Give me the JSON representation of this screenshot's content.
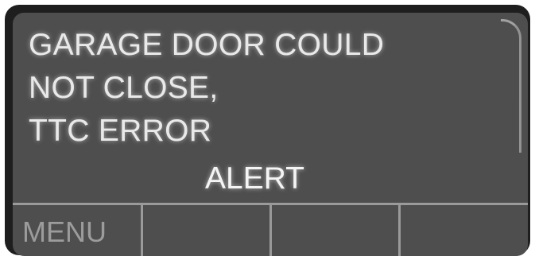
{
  "display": {
    "message_lines": [
      "GARAGE DOOR COULD",
      "NOT CLOSE,",
      "TTC ERROR"
    ],
    "alert_label": "ALERT"
  },
  "softkeys": [
    {
      "label": "MENU"
    },
    {
      "label": ""
    },
    {
      "label": ""
    },
    {
      "label": ""
    }
  ]
}
